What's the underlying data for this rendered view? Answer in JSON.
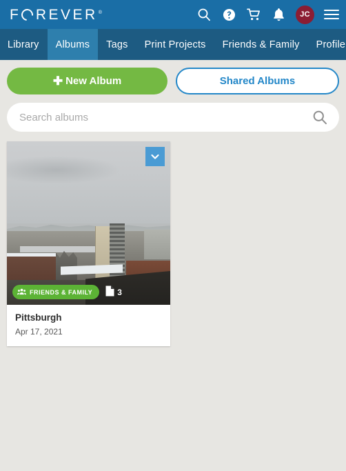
{
  "header": {
    "logo_pre": "F",
    "logo_post": "REVER",
    "logo_registered": "®",
    "icons": {
      "search": "search-icon",
      "help": "question-circle-icon",
      "cart": "shopping-cart-icon",
      "notifications": "bell-icon",
      "menu": "hamburger-menu-icon"
    },
    "avatar_initials": "JC",
    "colors": {
      "header_bg": "#1a6ea6",
      "avatar_bg": "#8b1d33"
    }
  },
  "nav": {
    "active": "Albums",
    "items": [
      {
        "label": "Library"
      },
      {
        "label": "Albums"
      },
      {
        "label": "Tags"
      },
      {
        "label": "Print Projects"
      },
      {
        "label": "Friends & Family"
      },
      {
        "label": "Profile"
      }
    ],
    "colors": {
      "nav_bg": "#1d5b82",
      "active_bg": "#2e7fad"
    }
  },
  "actions": {
    "new_album_label": "New Album",
    "new_album_plus": "✚",
    "shared_albums_label": "Shared Albums",
    "colors": {
      "new_album_bg": "#74b943",
      "shared_albums_accent": "#2387c8"
    }
  },
  "search": {
    "placeholder": "Search albums",
    "value": "",
    "icon": "search-icon"
  },
  "albums": [
    {
      "title": "Pittsburgh",
      "date": "Apr 17, 2021",
      "photo_count": "3",
      "share_badge": "FRIENDS & FAMILY",
      "share_badge_icon": "people-group-icon",
      "count_icon": "document-icon",
      "menu_icon": "chevron-down-icon",
      "thumbnail_alt": "Snowy cityscape with rooftops and apartment towers",
      "badge_color": "#5cb335",
      "menu_button_color": "#4a9bd4"
    }
  ],
  "page": {
    "background": "#e7e6e2"
  }
}
